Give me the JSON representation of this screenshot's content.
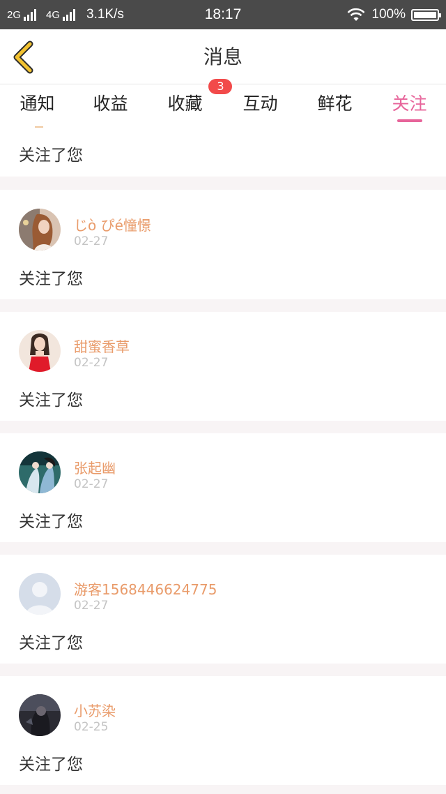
{
  "status_bar": {
    "network_1": "2G",
    "network_2": "4G",
    "speed": "3.1K/s",
    "time": "18:17",
    "battery": "100%"
  },
  "header": {
    "title": "消息",
    "back_icon": "chevron-left-icon",
    "accent_color": "#e7649a",
    "back_color": "#f2c230"
  },
  "tabs": [
    {
      "label": "通知"
    },
    {
      "label": "收益"
    },
    {
      "label": "收藏",
      "badge": "3"
    },
    {
      "label": "互动"
    },
    {
      "label": "鲜花"
    },
    {
      "label": "关注",
      "active": true
    }
  ],
  "feed": {
    "partial_item": {
      "message": "关注了您"
    },
    "items": [
      {
        "name": "じò ぴé憧憬",
        "date": "02-27",
        "message": "关注了您",
        "avatar": "photo-avatar"
      },
      {
        "name": "甜蜜香草",
        "date": "02-27",
        "message": "关注了您",
        "avatar": "photo-avatar"
      },
      {
        "name": "张起幽",
        "date": "02-27",
        "message": "关注了您",
        "avatar": "photo-avatar"
      },
      {
        "name": "游客1568446624775",
        "date": "02-27",
        "message": "关注了您",
        "avatar": "default-user-avatar"
      },
      {
        "name": "小苏染",
        "date": "02-25",
        "message": "关注了您",
        "avatar": "photo-avatar"
      }
    ]
  }
}
